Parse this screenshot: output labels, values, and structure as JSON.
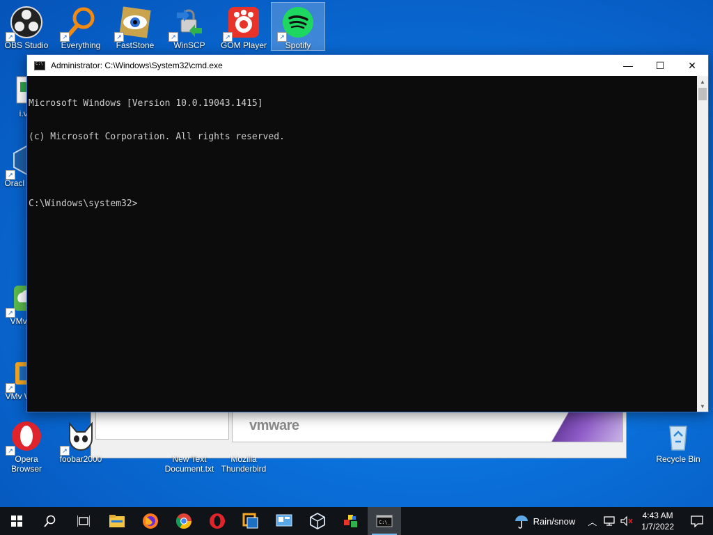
{
  "desktop_icons": [
    {
      "label": "OBS Studio"
    },
    {
      "label": "Everything"
    },
    {
      "label": "FastStone"
    },
    {
      "label": "WinSCP"
    },
    {
      "label": "GOM Player"
    },
    {
      "label": "Spotify"
    },
    {
      "label": "i.vC"
    },
    {
      "label": "Oracl Virtua"
    },
    {
      "label": "VMv Hor"
    },
    {
      "label": "VMv Works"
    },
    {
      "label": "Opera Browser"
    },
    {
      "label": "foobar2000"
    },
    {
      "label": "New Text Document.txt"
    },
    {
      "label": "Mozilla Thunderbird"
    },
    {
      "label": "Recycle Bin"
    }
  ],
  "bg_window": {
    "logo": "vmware"
  },
  "cmd": {
    "title": "Administrator: C:\\Windows\\System32\\cmd.exe",
    "lines": [
      "Microsoft Windows [Version 10.0.19043.1415]",
      "(c) Microsoft Corporation. All rights reserved.",
      "",
      "C:\\Windows\\system32>"
    ],
    "minimize": "—",
    "maximize": "☐",
    "close": "✕"
  },
  "taskbar": {
    "weather": "Rain/snow",
    "time": "4:43 AM",
    "date": "1/7/2022"
  }
}
